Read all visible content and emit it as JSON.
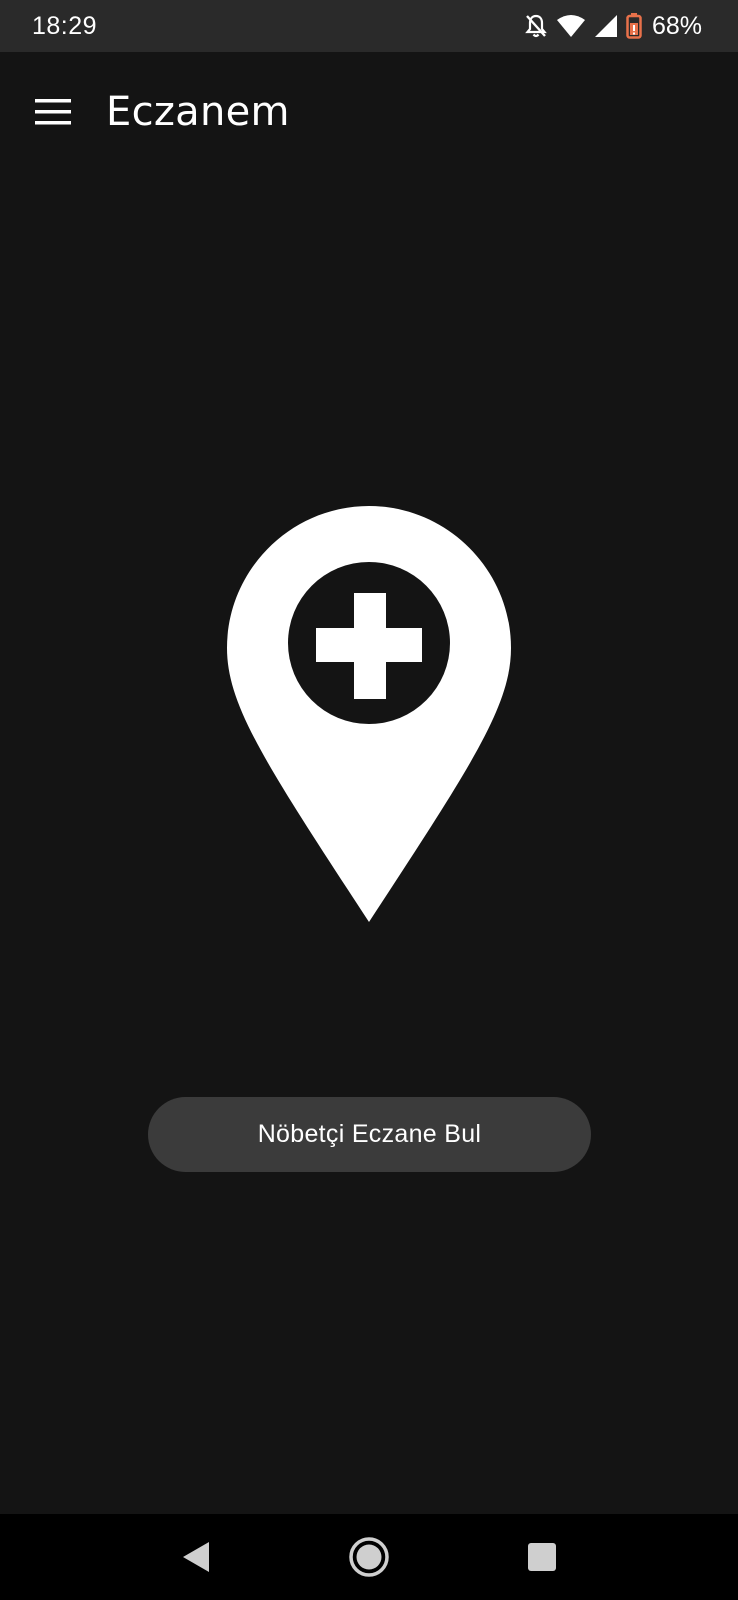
{
  "status_bar": {
    "time": "18:29",
    "battery_percent": "68%",
    "icons": [
      "bell-off-icon",
      "wifi-icon",
      "signal-icon",
      "battery-icon"
    ],
    "battery_color": "#e8714a"
  },
  "app_bar": {
    "menu_icon": "hamburger-menu-icon",
    "title": "Eczanem"
  },
  "main": {
    "logo_icon": "pharmacy-location-pin-icon",
    "find_button_label": "Nöbetçi Eczane Bul"
  },
  "nav_bar": {
    "icons": [
      "back-icon",
      "home-icon",
      "recents-icon"
    ]
  },
  "colors": {
    "background": "#141414",
    "status_bar": "#2a2a2a",
    "button": "#3b3b3b",
    "nav_bar": "#000000",
    "text": "#ffffff"
  }
}
